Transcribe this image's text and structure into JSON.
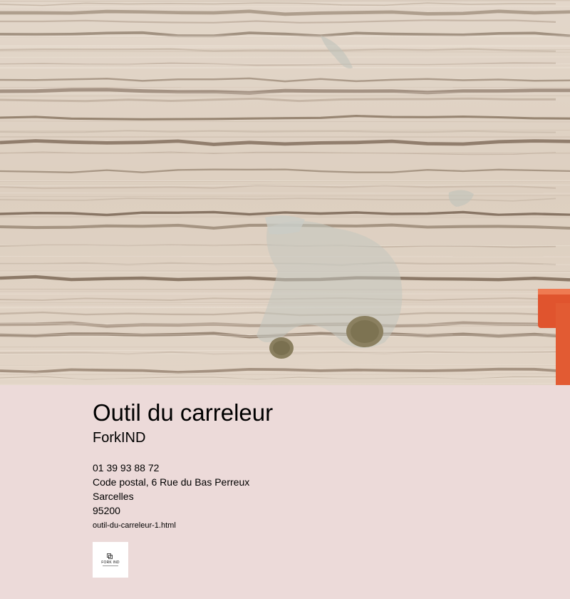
{
  "hero": {
    "image_alt": "photo-of-wooden-deck-with-mortar-spots",
    "colors": {
      "wood_light": "#ddd0c2",
      "wood_dark": "#7a6654",
      "mortar": "#b7bcb3",
      "orange": "#e0542e"
    }
  },
  "business": {
    "title": "Outil du carreleur",
    "name": "ForkIND",
    "phone": "01 39 93 88 72",
    "address": "Code postal, 6 Rue du Bas Perreux",
    "city": "Sarcelles",
    "postal_code": "95200",
    "link": "outil-du-carreleur-1.html",
    "logo_text": "FORK IND"
  },
  "colors": {
    "background": "#ecdad9",
    "text": "#000000"
  }
}
